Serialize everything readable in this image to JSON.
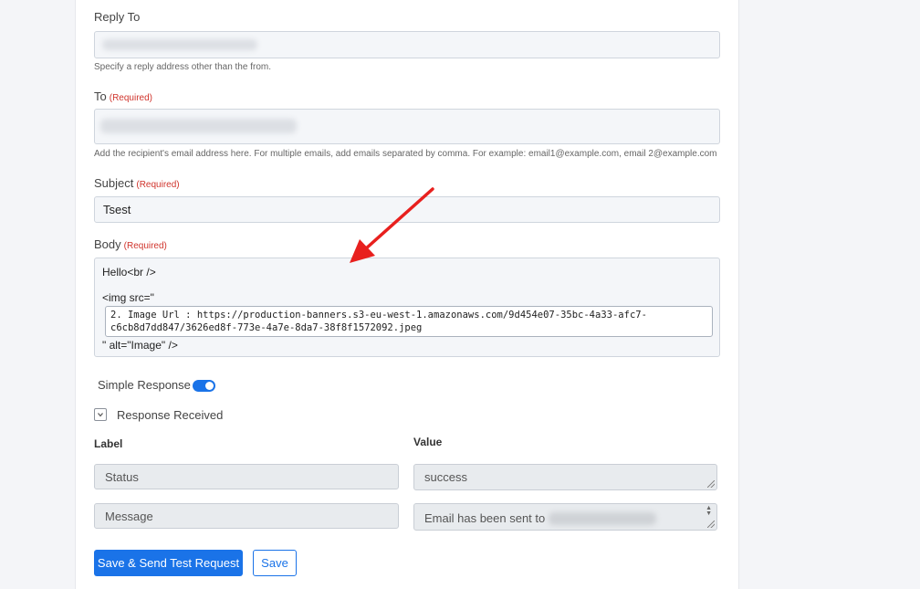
{
  "reply_to": {
    "label": "Reply To",
    "hint": "Specify a reply address other than the from."
  },
  "to": {
    "label": "To",
    "required": "(Required)",
    "hint": "Add the recipient's email address here. For multiple emails, add emails separated by comma. For example: email1@example.com, email 2@example.com"
  },
  "subject": {
    "label": "Subject",
    "required": "(Required)",
    "value": "Tsest"
  },
  "body": {
    "label": "Body",
    "required": "(Required)",
    "line1": "Hello<br />",
    "line2": "<img src=\"",
    "token_line1": "2. Image Url : https://production-banners.s3-eu-west-1.amazonaws.com/9d454e07-35bc-4a33-afc7-",
    "token_line2": "c6cb8d7dd847/3626ed8f-773e-4a7e-8da7-38f8f1572092.jpeg",
    "line3": "\" alt=\"Image\" />"
  },
  "simple_response": {
    "label": "Simple Response",
    "enabled": true
  },
  "response_received": {
    "label": "Response Received",
    "expanded": true
  },
  "response_table": {
    "col_label": "Label",
    "col_value": "Value",
    "rows": [
      {
        "label": "Status",
        "value": "success"
      },
      {
        "label": "Message",
        "value": "Email has been sent to"
      }
    ]
  },
  "actions": {
    "send_test": "Save & Send Test Request",
    "save": "Save"
  },
  "colors": {
    "primary": "#1a73e8",
    "required": "#d0342c",
    "arrow": "#e8201e"
  }
}
